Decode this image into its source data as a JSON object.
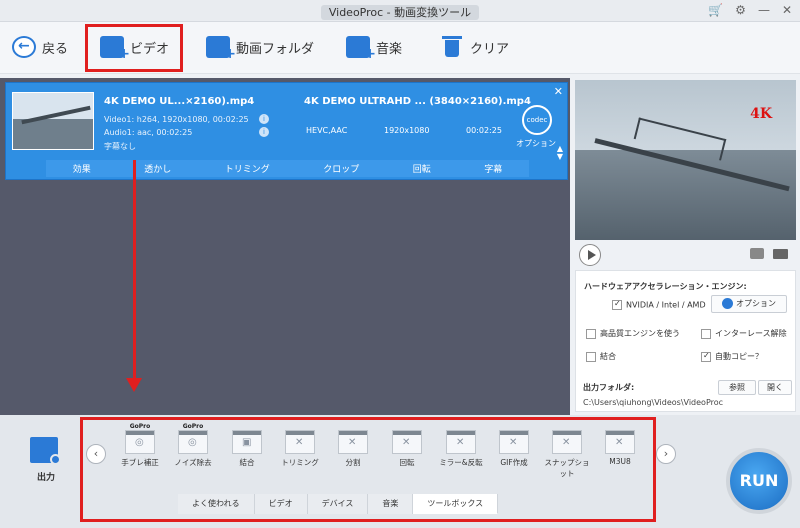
{
  "window": {
    "title": "VideoProc - 動画変換ツール"
  },
  "toolbar": {
    "back": "戻る",
    "video": "ビデオ",
    "folder": "動画フォルダ",
    "music": "音楽",
    "clear": "クリア"
  },
  "file": {
    "source_name": "4K DEMO UL...×2160).mp4",
    "video_info": "Video1: h264, 1920x1080, 00:02:25",
    "audio_info": "Audio1: aac, 00:02:25",
    "subtitle_info": "字幕なし",
    "output_name": "4K DEMO ULTRAHD ... (3840×2160).mp4",
    "output_codec": "HEVC,AAC",
    "output_res": "1920x1080",
    "output_duration": "00:02:25",
    "codec_label": "codec",
    "option_label": "オプション"
  },
  "editbar": [
    "効果",
    "透かし",
    "トリミング",
    "クロップ",
    "回転",
    "字幕"
  ],
  "preview": {
    "badge": "4K"
  },
  "settings": {
    "hw_title": "ハードウェアアクセラレーション・エンジン:",
    "nvidia": "NVIDIA / Intel / AMD",
    "option_button": "オプション",
    "high_quality": "高品質エンジンを使う",
    "deinterlace": "インターレース解除",
    "merge": "結合",
    "auto_copy": "自動コピー？"
  },
  "output": {
    "folder_label": "出力フォルダ:",
    "path": "C:\\Users\\qiuhong\\Videos\\VideoProc",
    "browse": "参照",
    "open": "開く",
    "section_label": "出力"
  },
  "tools": [
    {
      "label": "手ブレ補正",
      "gopro": "GoPro"
    },
    {
      "label": "ノイズ除去",
      "gopro": "GoPro"
    },
    {
      "label": "結合",
      "gopro": ""
    },
    {
      "label": "トリミング",
      "gopro": ""
    },
    {
      "label": "分割",
      "gopro": ""
    },
    {
      "label": "回転",
      "gopro": ""
    },
    {
      "label": "ミラー&反転",
      "gopro": ""
    },
    {
      "label": "GIF作成",
      "gopro": ""
    },
    {
      "label": "スナップショット",
      "gopro": ""
    },
    {
      "label": "M3U8",
      "gopro": ""
    }
  ],
  "tabs": [
    "よく使われる",
    "ビデオ",
    "デバイス",
    "音楽",
    "ツールボックス"
  ],
  "run_label": "RUN"
}
